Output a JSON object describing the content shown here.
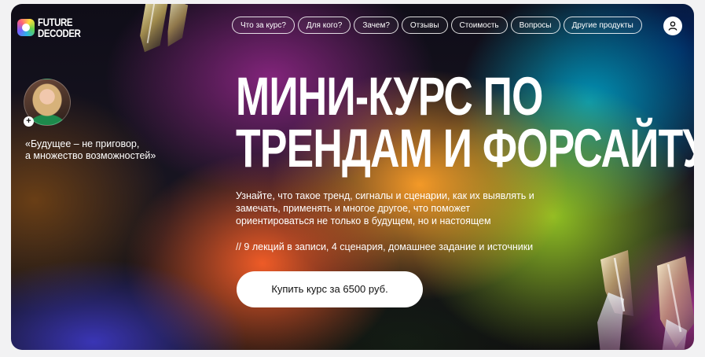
{
  "brand": {
    "logo_line1": "FUTURE",
    "logo_line2": "DECODER",
    "logo_icon": "future-decoder-logo-mark"
  },
  "nav": {
    "items": [
      {
        "label": "Что за курс?"
      },
      {
        "label": "Для кого?"
      },
      {
        "label": "Зачем?"
      },
      {
        "label": "Отзывы"
      },
      {
        "label": "Стоимость"
      },
      {
        "label": "Вопросы"
      },
      {
        "label": "Другие продукты"
      }
    ],
    "user_icon": "user-icon"
  },
  "author": {
    "plus_icon": "+",
    "quote_line1": "«Будущее – не приговор,",
    "quote_line2": "а множество возможностей»"
  },
  "hero": {
    "title_line1": "МИНИ-КУРС ПО",
    "title_line2": "ТРЕНДАМ И ФОРСАЙТУ",
    "description": "Узнайте, что такое тренд, сигналы и сценарии, как их выявлять и замечать, применять и многое другое, что поможет ориентироваться не только в будущем, но и настоящем",
    "details": "// 9 лекций в записи, 4 сценария, домашнее задание и источники",
    "buy_label": "Купить курс за 6500 руб."
  },
  "colors": {
    "button_bg": "#ffffff",
    "text": "#ffffff",
    "page_bg": "#f2f2f3"
  }
}
